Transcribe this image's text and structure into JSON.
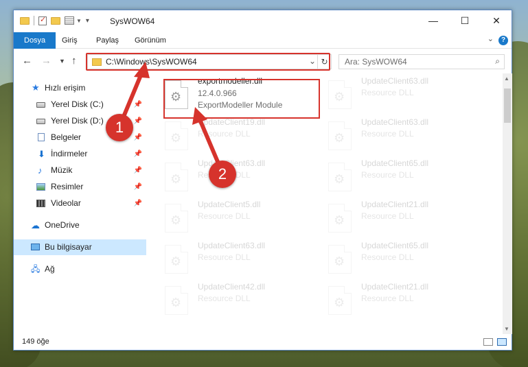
{
  "window": {
    "title": "SysWOW64",
    "controls": {
      "minimize": "—",
      "maximize": "☐",
      "close": "✕"
    }
  },
  "ribbon": {
    "tabs": [
      "Dosya",
      "Giriş",
      "Paylaş",
      "Görünüm"
    ]
  },
  "address": {
    "path": "C:\\Windows\\SysWOW64",
    "search_placeholder": "Ara: SysWOW64"
  },
  "nav": {
    "items": [
      {
        "label": "Hızlı erişim",
        "icon": "star-icon",
        "pinned": false
      },
      {
        "label": "Yerel Disk (C:)",
        "icon": "drive-icon",
        "pinned": true
      },
      {
        "label": "Yerel Disk (D:)",
        "icon": "drive-icon",
        "pinned": true
      },
      {
        "label": "Belgeler",
        "icon": "document-icon",
        "pinned": true
      },
      {
        "label": "İndirmeler",
        "icon": "download-icon",
        "pinned": true
      },
      {
        "label": "Müzik",
        "icon": "music-icon",
        "pinned": true
      },
      {
        "label": "Resimler",
        "icon": "pictures-icon",
        "pinned": true
      },
      {
        "label": "Videolar",
        "icon": "videos-icon",
        "pinned": true
      },
      {
        "label": "OneDrive",
        "icon": "cloud-icon",
        "pinned": false
      },
      {
        "label": "Bu bilgisayar",
        "icon": "computer-icon",
        "pinned": false,
        "selected": true
      },
      {
        "label": "Ağ",
        "icon": "network-icon",
        "pinned": false
      }
    ]
  },
  "files": {
    "main": {
      "name": "exportmodeller.dll",
      "version": "12.4.0.966",
      "description": "ExportModeller Module"
    },
    "left_column": [
      {
        "name": "UpdateClient19.dll",
        "description": "Resource DLL"
      },
      {
        "name": "UpdateClient63.dll",
        "description": "Resource DLL"
      },
      {
        "name": "UpdateClient5.dll",
        "description": "Resource DLL"
      },
      {
        "name": "UpdateClient63.dll",
        "description": "Resource DLL"
      },
      {
        "name": "UpdateClient42.dll",
        "description": "Resource DLL"
      }
    ],
    "right_column": [
      {
        "name": "UpdateClient63.dll",
        "description": "Resource DLL"
      },
      {
        "name": "UpdateClient63.dll",
        "description": "Resource DLL"
      },
      {
        "name": "UpdateClient65.dll",
        "description": "Resource DLL"
      },
      {
        "name": "UpdateClient21.dll",
        "description": "Resource DLL"
      },
      {
        "name": "UpdateClient65.dll",
        "description": "Resource DLL"
      },
      {
        "name": "UpdateClient21.dll",
        "description": "Resource DLL"
      }
    ]
  },
  "status": {
    "count": "149 öğe"
  },
  "callouts": [
    "1",
    "2"
  ],
  "colors": {
    "accent": "#1979ca",
    "highlight": "#d6332c",
    "selection": "#cce8ff"
  }
}
